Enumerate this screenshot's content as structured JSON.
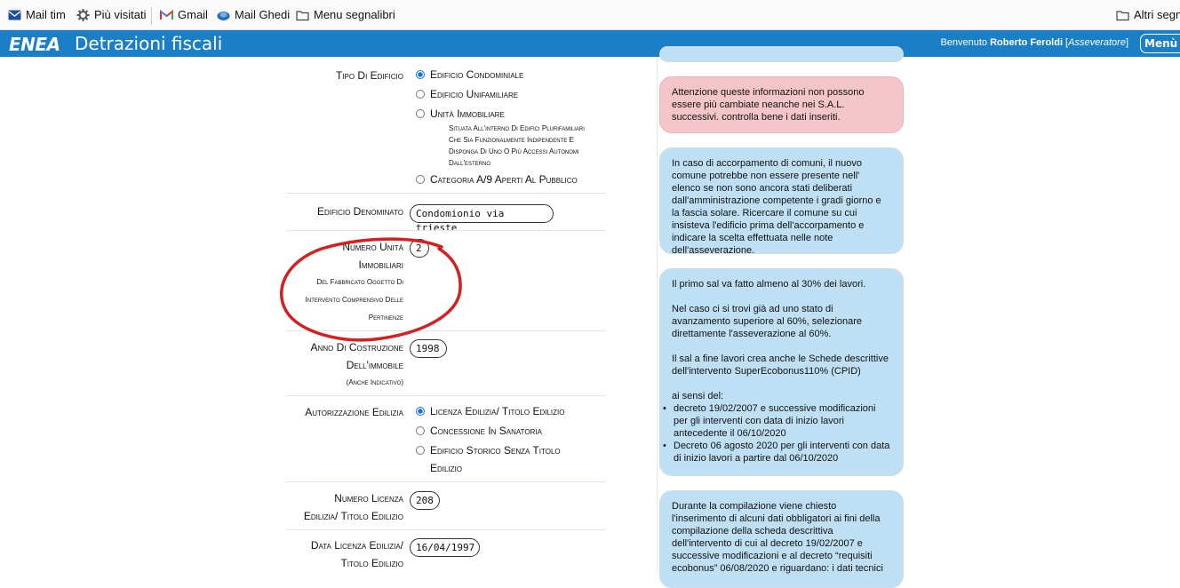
{
  "bookmarks": {
    "items": [
      {
        "label": "Mail tim"
      },
      {
        "label": "Più visitati"
      },
      {
        "label": "Gmail"
      },
      {
        "label": "Mail Ghedi"
      },
      {
        "label": "Menu segnalibri"
      }
    ],
    "other": "Altri segna"
  },
  "header": {
    "logo": "ENEA",
    "title": "Detrazioni fiscali",
    "welcome_prefix": "Benvenuto",
    "user": "Roberto Feroldi",
    "role": "Asseveratore",
    "menu": "Menù"
  },
  "form": {
    "tipo_edificio": {
      "label": "Tipo Di Edificio",
      "options": [
        "Edificio Condominiale",
        "Edificio Unifamiliare",
        "Unità Immobiliare",
        "Categoria A/9 Aperti Al Pubblico"
      ],
      "selected": "Edificio Condominiale",
      "unita_note": [
        "Situata All'interno Di Edifici Plurifamiliari",
        "Che Sia Funzionalmente Indipendente E",
        "Disponga Di Uno O Più Accessi Autonomi",
        "Dall'esterno"
      ]
    },
    "edificio_denominato": {
      "label": "Edificio Denominato",
      "value": "Condomionio via trieste"
    },
    "numero_unita": {
      "label": [
        "Numero Unità",
        "Immobiliari"
      ],
      "sublabel": [
        "Del Fabbricato Oggetto Di",
        "Intervento Comprensivo Delle",
        "Pertinenze"
      ],
      "value": "2"
    },
    "anno_costruzione": {
      "label": [
        "Anno Di Costruzione",
        "Dell'immobile"
      ],
      "sublabel": "(Anche Indicativo)",
      "value": "1998"
    },
    "autorizzazione": {
      "label": "Autorizzazione Edilizia",
      "options": [
        "Licenza Edilizia/ Titolo Edilizio",
        "Concessione In Sanatoria",
        "Edificio Storico Senza Titolo",
        "Edilizio"
      ],
      "selected": "Licenza Edilizia/ Titolo Edilizio"
    },
    "numero_licenza": {
      "label": [
        "Numero Licenza",
        "Edilizia/ Titolo Edilizio"
      ],
      "value": "208"
    },
    "data_licenza": {
      "label": [
        "Data Licenza Edilizia/",
        "Titolo Edilizio"
      ],
      "value": "16/04/1997"
    }
  },
  "notes": {
    "warning": "Attenzione queste informazioni non possono essere più cambiate neanche nei S.A.L. successivi. controlla bene i dati inseriti.",
    "comuni": "In caso di accorpamento di comuni, il nuovo comune potrebbe non essere presente nell' elenco se non sono ancora stati deliberati dall'amministrazione competente i gradi giorno e la fascia solare. Ricercare il comune su cui insisteva l'edificio prima dell'accorpamento e indicare la scelta effettuata nelle note dell'asseverazione.",
    "sal": {
      "p1": "Il primo sal va fatto almeno al 30% dei lavori.",
      "p2": "Nel caso ci si trovi già ad uno stato di avanzamento superiore al 60%, selezionare direttamente l'asseverazione al 60%.",
      "p3": "Il sal a fine lavori crea anche le Schede descrittive dell'intervento SuperEcobonus110% (CPID)",
      "p4": "ai sensi del:",
      "bullets": [
        "decreto 19/02/2007 e successive modificazioni per gli interventi con data di inizio lavori antecedente il 06/10/2020",
        "Decreto 06 agosto 2020 per gli interventi con data di inizio lavori a partire dal 06/10/2020"
      ]
    },
    "compilazione": "Durante la compilazione viene chiesto l'inserimento di alcuni dati obbligatori ai fini della compilazione della scheda descrittiva dell'intervento di cui al decreto 19/02/2007 e successive modificazioni e al decreto “requisiti ecobonus” 06/08/2020 e riguardano: i dati tecnici"
  },
  "colors": {
    "header": "#1a7fc7",
    "note_blue": "#bfe0f4",
    "note_pink": "#f4c5c9",
    "annotation": "#d42020"
  }
}
